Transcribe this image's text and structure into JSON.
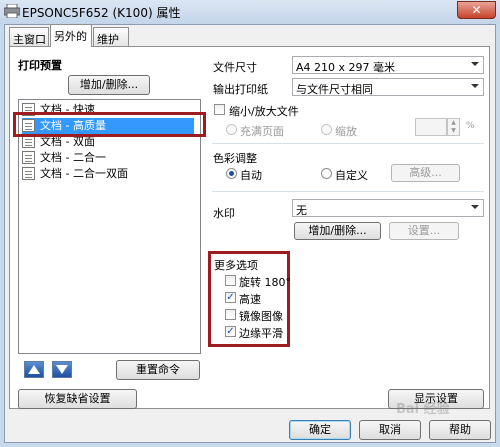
{
  "window": {
    "title": "EPSONC5F652 (K100) 属性",
    "close": "✕"
  },
  "tabs": [
    "主窗口",
    "另外的",
    "维护"
  ],
  "preview": {
    "heading": "打印预置",
    "add_delete": "增加/删除...",
    "items": [
      "文档 - 快速",
      "文档 - 高质量",
      "文档 - 双面",
      "文档 - 二合一",
      "文档 - 二合一双面"
    ],
    "selected_index": 1,
    "reset": "重置命令",
    "restore_defaults": "恢复缺省设置"
  },
  "paper": {
    "document_size_label": "文件尺寸",
    "document_size_value": "A4 210 x 297 毫米",
    "output_paper_label": "输出打印纸",
    "output_paper_value": "与文件尺寸相同",
    "reduce_enlarge": "缩小/放大文件",
    "fit_page": "充满页面",
    "zoom": "缩放",
    "zoom_value": "",
    "percent": "%"
  },
  "color": {
    "heading": "色彩调整",
    "auto": "自动",
    "custom": "自定义",
    "advanced": "高级..."
  },
  "watermark": {
    "label": "水印",
    "value": "无",
    "add_delete": "增加/删除...",
    "settings": "设置..."
  },
  "more": {
    "heading": "更多选项",
    "options": [
      {
        "label": "旋转 180°",
        "checked": false
      },
      {
        "label": "高速",
        "checked": true
      },
      {
        "label": "镜像图像",
        "checked": false
      },
      {
        "label": "边缘平滑",
        "checked": true
      }
    ]
  },
  "show_settings": "显示设置",
  "footer": {
    "ok": "确定",
    "cancel": "取消",
    "help": "帮助"
  },
  "watermark_overlay": "Bai 经验",
  "colors": {
    "highlight": "#3399ff",
    "annotation": "#9e1b20"
  }
}
